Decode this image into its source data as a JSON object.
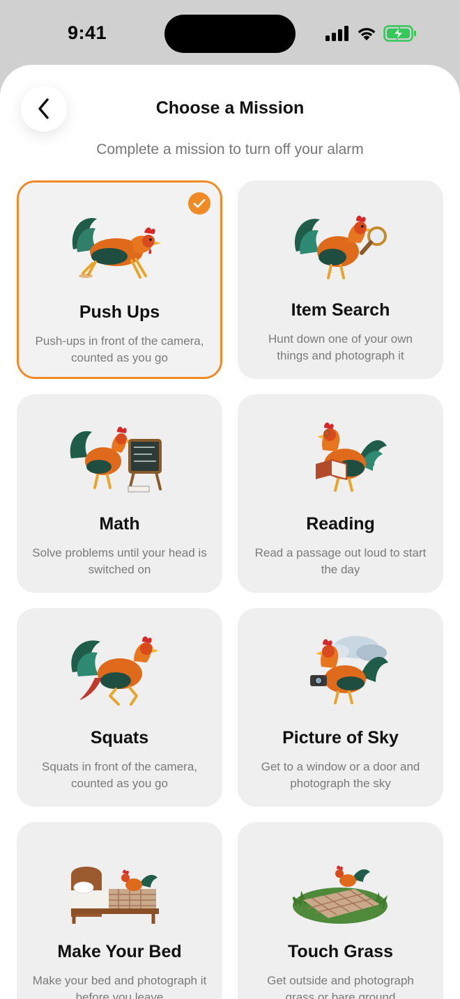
{
  "status_bar": {
    "time": "9:41"
  },
  "header": {
    "title": "Choose a Mission",
    "subtitle": "Complete a mission to turn off your alarm",
    "back_icon": "chevron-left-icon"
  },
  "accent_color": "#f08a24",
  "missions": [
    {
      "title": "Push Ups",
      "description": "Push-ups in front of the camera, counted as you go",
      "selected": true,
      "art": "rooster-pushup-illustration"
    },
    {
      "title": "Item Search",
      "description": "Hunt down one of your own things and photograph it",
      "selected": false,
      "art": "rooster-magnifier-illustration"
    },
    {
      "title": "Math",
      "description": "Solve problems until your head is switched on",
      "selected": false,
      "art": "rooster-chalkboard-illustration"
    },
    {
      "title": "Reading",
      "description": "Read a passage out loud to start the day",
      "selected": false,
      "art": "rooster-book-illustration"
    },
    {
      "title": "Squats",
      "description": "Squats in front of the camera, counted as you go",
      "selected": false,
      "art": "rooster-squat-illustration"
    },
    {
      "title": "Picture of Sky",
      "description": "Get to a window or a door and photograph the sky",
      "selected": false,
      "art": "rooster-camera-sky-illustration"
    },
    {
      "title": "Make Your Bed",
      "description": "Make your bed and photograph it before you leave",
      "selected": false,
      "art": "rooster-bed-illustration"
    },
    {
      "title": "Touch Grass",
      "description": "Get outside and photograph grass or bare ground",
      "selected": false,
      "art": "rooster-grass-illustration"
    }
  ]
}
